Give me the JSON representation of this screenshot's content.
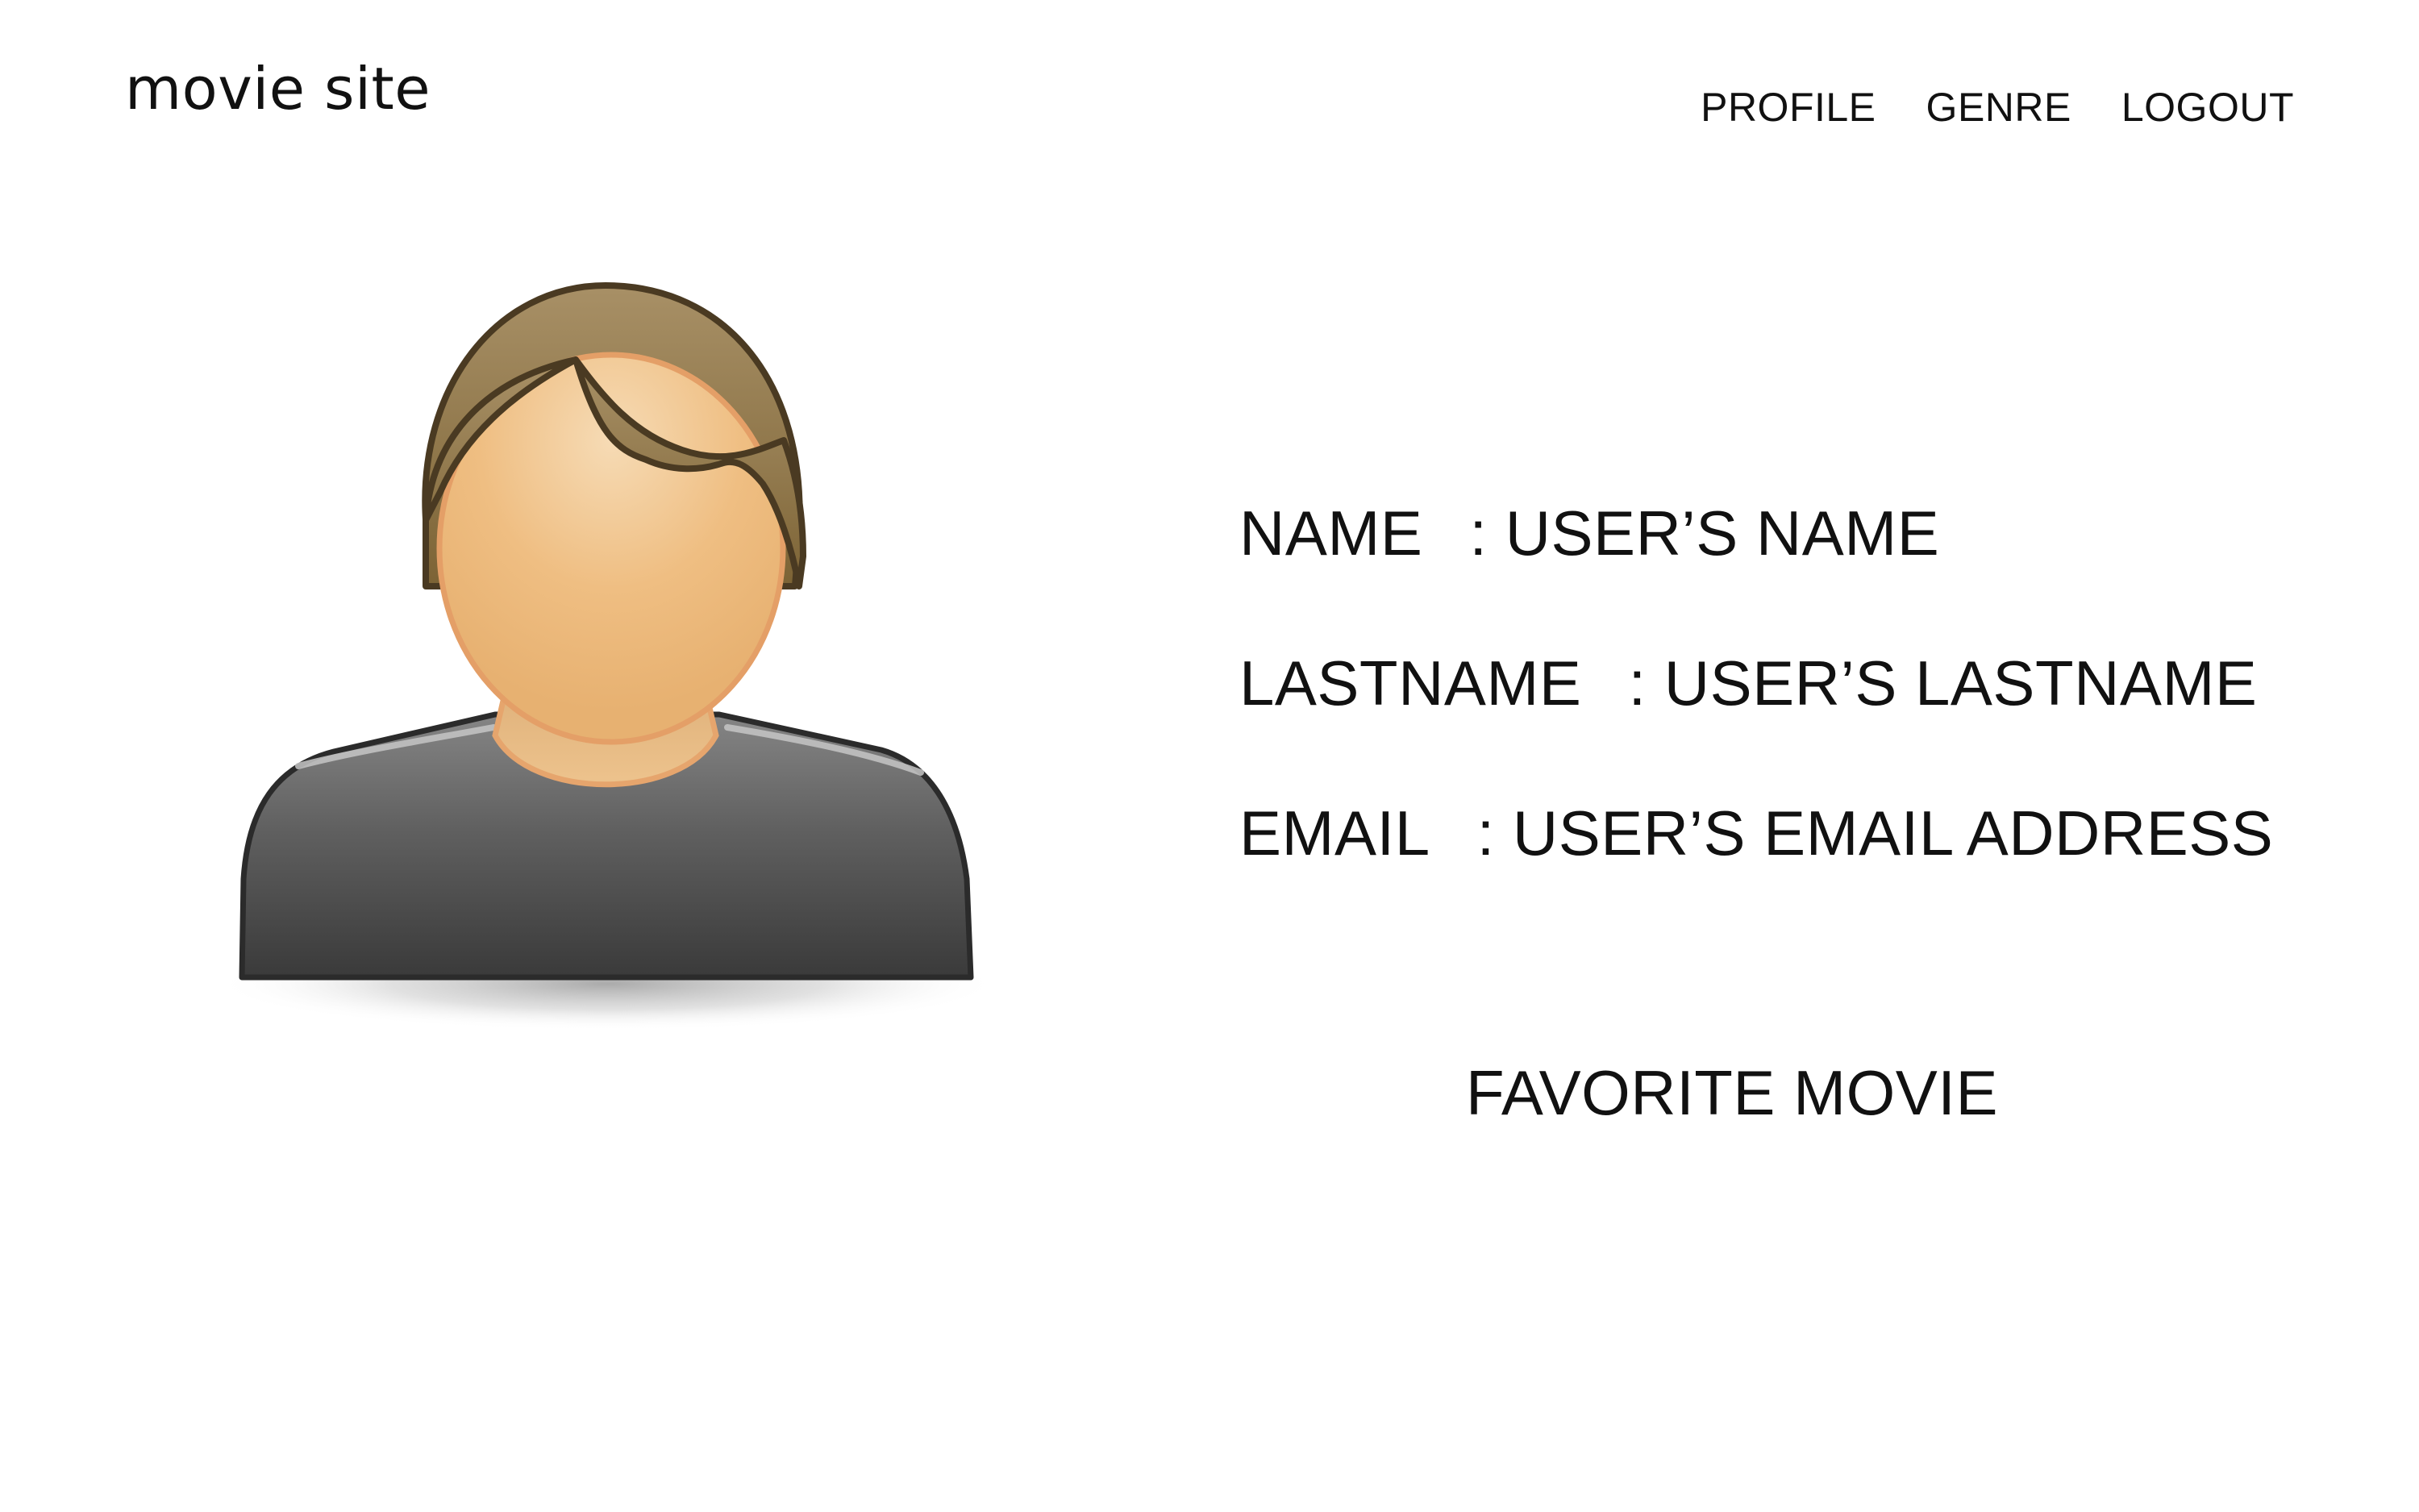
{
  "site": {
    "title": "movie site"
  },
  "nav": {
    "items": [
      {
        "label": "PROFILE"
      },
      {
        "label": "GENRE"
      },
      {
        "label": "LOGOUT"
      }
    ]
  },
  "profile": {
    "avatar": "user-avatar-icon",
    "fields": [
      {
        "label": "NAME",
        "value": ": USER’S NAME"
      },
      {
        "label": "LASTNAME",
        "value": ": USER’S LASTNAME"
      },
      {
        "label": "EMAIL",
        "value": ": USER’S EMAIL ADDRESS"
      }
    ],
    "favorite_movie": "FAVORITE MOVIE"
  },
  "colors": {
    "text": "#111111",
    "hair": "#8b7347",
    "skin": "#efbe82",
    "shirt": "#555555",
    "outline": "#4a3a22"
  }
}
